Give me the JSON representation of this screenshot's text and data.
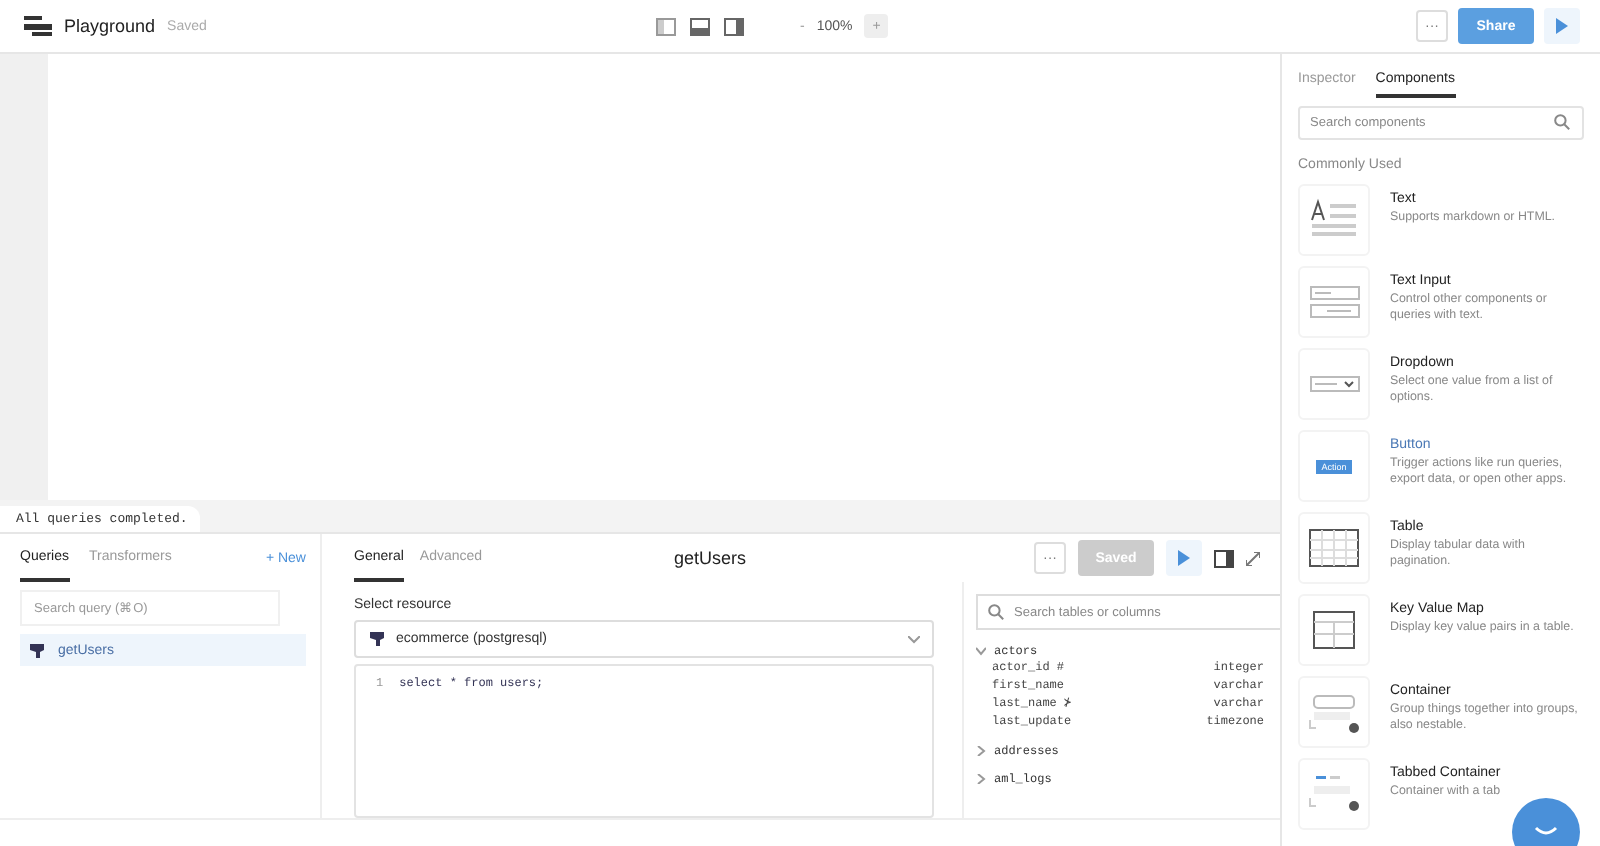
{
  "app": {
    "title": "Playground",
    "save_state": "Saved",
    "zoom": "100%",
    "zoom_out": "-",
    "zoom_in": "+",
    "more": "···",
    "share": "Share"
  },
  "status_message": "All queries completed.",
  "query_panel": {
    "tabs": [
      {
        "label": "Queries",
        "selected": true
      },
      {
        "label": "Transformers",
        "selected": false
      }
    ],
    "new_label": "+ New",
    "search": {
      "placeholder": "Search query (⌘O)"
    },
    "queries": [
      {
        "name": "getUsers",
        "selected": true
      }
    ]
  },
  "editor": {
    "tabs": [
      {
        "label": "General",
        "selected": true
      },
      {
        "label": "Advanced",
        "selected": false
      }
    ],
    "query_name": "getUsers",
    "more": "···",
    "save_button": {
      "label": "Saved",
      "disabled": true
    },
    "resource_label": "Select resource",
    "resource": "ecommerce (postgresql)",
    "code_lines": [
      {
        "number": "1",
        "code": "select * from users;"
      }
    ]
  },
  "schema": {
    "search": {
      "placeholder": "Search tables or columns"
    },
    "tables": [
      {
        "name": "actors",
        "expanded": true,
        "children": [
          {
            "name": "actor_id #",
            "type": "integer"
          },
          {
            "name": "first_name",
            "type": "varchar"
          },
          {
            "name": "last_name ⊁",
            "type": "varchar"
          },
          {
            "name": "last_update",
            "type": "timezone"
          }
        ]
      },
      {
        "name": "addresses",
        "expanded": false
      },
      {
        "name": "aml_logs",
        "expanded": false
      }
    ]
  },
  "right_panel": {
    "tabs": [
      {
        "label": "Inspector",
        "selected": false
      },
      {
        "label": "Components",
        "selected": true
      }
    ],
    "search": {
      "placeholder": "Search components"
    },
    "section": "Commonly Used",
    "components": [
      {
        "kind": "text",
        "name": "Text",
        "description": "Supports markdown or HTML.",
        "highlighted": false
      },
      {
        "kind": "text_input",
        "name": "Text Input",
        "description": "Control other components or queries with text.",
        "highlighted": false
      },
      {
        "kind": "dropdown",
        "name": "Dropdown",
        "description": "Select one value from a list of options.",
        "highlighted": false
      },
      {
        "kind": "button",
        "name": "Button",
        "description": "Trigger actions like run queries, export data, or open other apps.",
        "thumb_label": "Action",
        "highlighted": true
      },
      {
        "kind": "table",
        "name": "Table",
        "description": "Display tabular data with pagination.",
        "highlighted": false
      },
      {
        "kind": "key_value",
        "name": "Key Value Map",
        "description": "Display key value pairs in a table.",
        "highlighted": false
      },
      {
        "kind": "container",
        "name": "Container",
        "description": "Group things together into groups, also nestable.",
        "highlighted": false
      },
      {
        "kind": "tabbed_container",
        "name": "Tabbed Container",
        "description": "Container with a tab",
        "highlighted": false
      }
    ]
  }
}
